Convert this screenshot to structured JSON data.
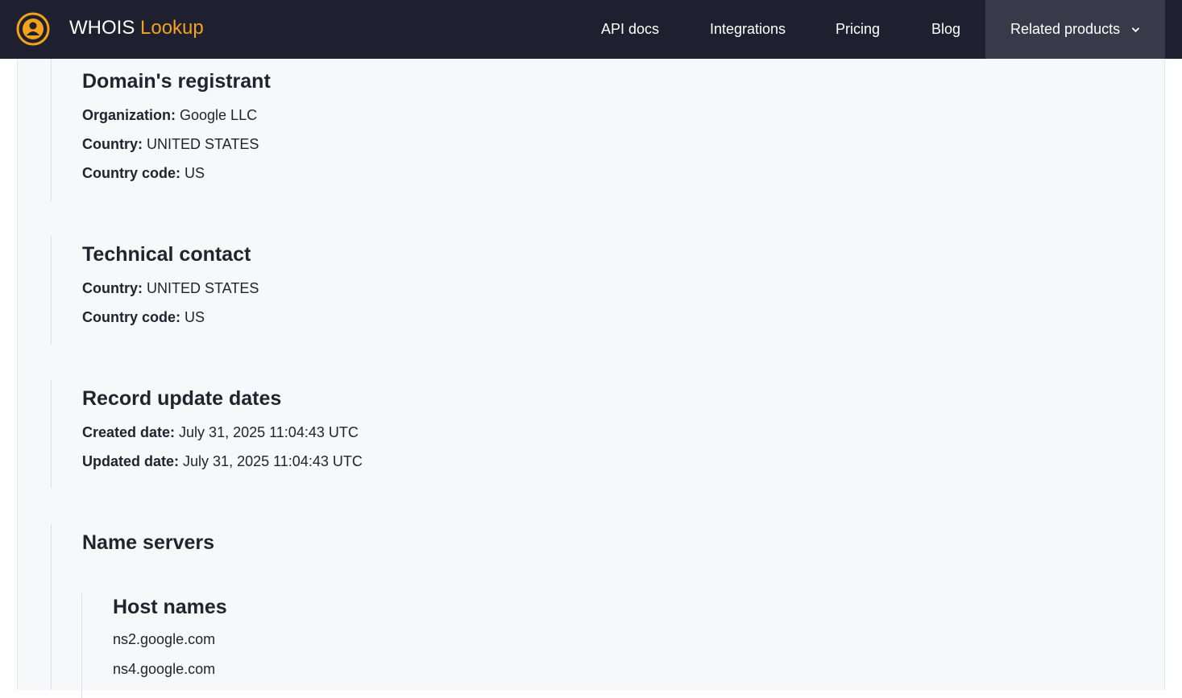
{
  "header": {
    "brand_main": "WHOIS",
    "brand_accent": "Lookup",
    "nav": [
      "API docs",
      "Integrations",
      "Pricing",
      "Blog"
    ],
    "related_label": "Related products",
    "logo_icon": "whois-logo-icon",
    "chevron_icon": "chevron-down-icon",
    "colors": {
      "bar": "#1e202f",
      "accent": "#f4a11b",
      "related_bg": "#383a4a"
    }
  },
  "registrant": {
    "title": "Domain's registrant",
    "rows": [
      {
        "label": "Organization:",
        "value": "Google LLC"
      },
      {
        "label": "Country:",
        "value": "UNITED STATES"
      },
      {
        "label": "Country code:",
        "value": "US"
      }
    ]
  },
  "technical": {
    "title": "Technical contact",
    "rows": [
      {
        "label": "Country:",
        "value": "UNITED STATES"
      },
      {
        "label": "Country code:",
        "value": "US"
      }
    ]
  },
  "dates": {
    "title": "Record update dates",
    "rows": [
      {
        "label": "Created date:",
        "value": "July 31, 2025 11:04:43 UTC"
      },
      {
        "label": "Updated date:",
        "value": "July 31, 2025 11:04:43 UTC"
      }
    ]
  },
  "nameservers": {
    "title": "Name servers",
    "host_title": "Host names",
    "hosts": [
      "ns2.google.com",
      "ns4.google.com"
    ]
  }
}
